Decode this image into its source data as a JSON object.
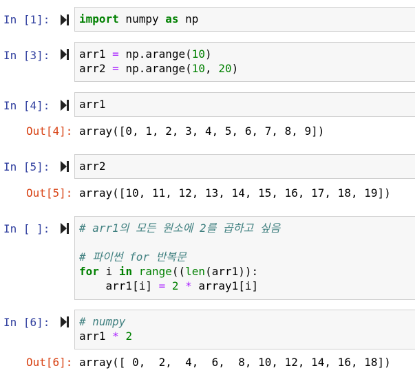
{
  "cells": [
    {
      "in_prompt": "In [1]:",
      "code": [
        [
          {
            "t": "import",
            "c": "kw"
          },
          {
            "t": " numpy ",
            "c": ""
          },
          {
            "t": "as",
            "c": "kw"
          },
          {
            "t": " np",
            "c": ""
          }
        ]
      ]
    },
    {
      "in_prompt": "In [3]:",
      "code": [
        [
          {
            "t": "arr1 ",
            "c": ""
          },
          {
            "t": "=",
            "c": "op"
          },
          {
            "t": " np.arange(",
            "c": ""
          },
          {
            "t": "10",
            "c": "num"
          },
          {
            "t": ")",
            "c": ""
          }
        ],
        [
          {
            "t": "arr2 ",
            "c": ""
          },
          {
            "t": "=",
            "c": "op"
          },
          {
            "t": " np.arange(",
            "c": ""
          },
          {
            "t": "10",
            "c": "num"
          },
          {
            "t": ", ",
            "c": ""
          },
          {
            "t": "20",
            "c": "num"
          },
          {
            "t": ")",
            "c": ""
          }
        ]
      ]
    },
    {
      "in_prompt": "In [4]:",
      "code": [
        [
          {
            "t": "arr1",
            "c": ""
          }
        ]
      ],
      "out_prompt": "Out[4]:",
      "output": "array([0, 1, 2, 3, 4, 5, 6, 7, 8, 9])"
    },
    {
      "in_prompt": "In [5]:",
      "code": [
        [
          {
            "t": "arr2",
            "c": ""
          }
        ]
      ],
      "out_prompt": "Out[5]:",
      "output": "array([10, 11, 12, 13, 14, 15, 16, 17, 18, 19])"
    },
    {
      "in_prompt": "In [ ]:",
      "code": [
        [
          {
            "t": "# arr1의 모든 원소에 2를 곱하고 싶음",
            "c": "cm"
          }
        ],
        [
          {
            "t": "",
            "c": ""
          }
        ],
        [
          {
            "t": "# 파이썬 for 반복문",
            "c": "cm"
          }
        ],
        [
          {
            "t": "for",
            "c": "kw"
          },
          {
            "t": " i ",
            "c": ""
          },
          {
            "t": "in",
            "c": "kw"
          },
          {
            "t": " ",
            "c": ""
          },
          {
            "t": "range",
            "c": "bi"
          },
          {
            "t": "((",
            "c": ""
          },
          {
            "t": "len",
            "c": "bi"
          },
          {
            "t": "(arr1)):",
            "c": ""
          }
        ],
        [
          {
            "t": "    arr1[i] ",
            "c": ""
          },
          {
            "t": "=",
            "c": "op"
          },
          {
            "t": " ",
            "c": ""
          },
          {
            "t": "2",
            "c": "num"
          },
          {
            "t": " ",
            "c": ""
          },
          {
            "t": "*",
            "c": "op"
          },
          {
            "t": " array1[i]",
            "c": ""
          }
        ]
      ]
    },
    {
      "in_prompt": "In [6]:",
      "code": [
        [
          {
            "t": "# numpy",
            "c": "cm"
          }
        ],
        [
          {
            "t": "arr1 ",
            "c": ""
          },
          {
            "t": "*",
            "c": "op"
          },
          {
            "t": " ",
            "c": ""
          },
          {
            "t": "2",
            "c": "num"
          }
        ]
      ],
      "out_prompt": "Out[6]:",
      "output": "array([ 0,  2,  4,  6,  8, 10, 12, 14, 16, 18])"
    }
  ]
}
